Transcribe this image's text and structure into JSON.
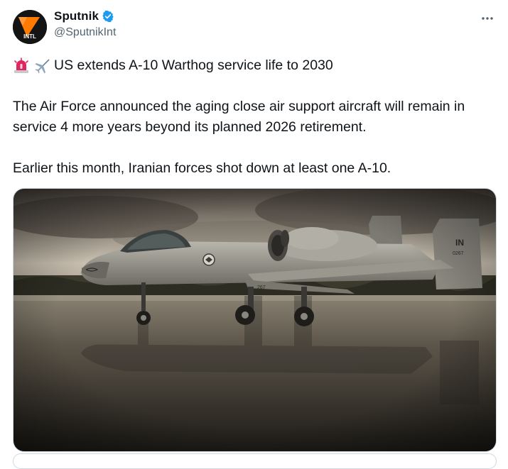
{
  "author": {
    "display_name": "Sputnik",
    "handle": "@SputnikInt",
    "avatar_text": "INTL",
    "verified": true
  },
  "tweet": {
    "headline": "US extends A-10 Warthog service life to 2030",
    "paragraph_1": "The Air Force announced the aging close air support aircraft will remain in service 4 more years beyond its planned 2026 retirement.",
    "paragraph_2": "Earlier this month, Iranian forces shot down at least one A-10.",
    "emojis": [
      "siren-icon",
      "airplane-icon"
    ]
  },
  "media": {
    "fin_code": "IN",
    "tail_number": "0267",
    "nose_number": "267"
  },
  "colors": {
    "verified_blue": "#1d9bf0",
    "avatar_orange": "#ff7a00",
    "secondary_text": "#536471",
    "border": "#cfd9de"
  }
}
